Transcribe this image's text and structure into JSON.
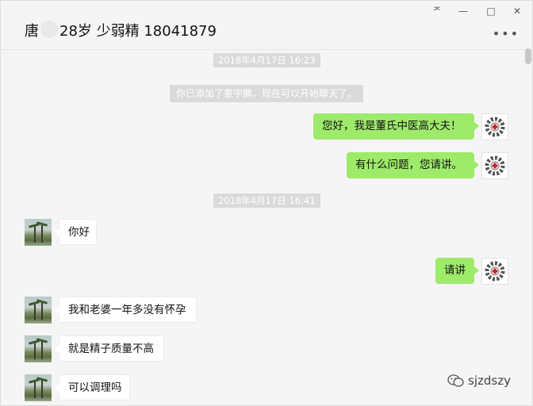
{
  "window": {
    "title_prefix": "唐",
    "title_suffix": "28岁 少弱精 18041879",
    "controls": [
      "ᅎ",
      "—",
      "□",
      "✕"
    ],
    "more_label": "•••"
  },
  "timestamps": [
    "2018年4月17日 16:23",
    "2018年4月17日 16:41"
  ],
  "system_message": "你已添加了董宇鹏，现在可以开始聊天了。",
  "messages": [
    {
      "side": "out",
      "text": "您好，我是董氏中医高大夫！"
    },
    {
      "side": "out",
      "text": "有什么问题，您请讲。"
    },
    {
      "side": "in",
      "text": "你好"
    },
    {
      "side": "out",
      "text": "请讲"
    },
    {
      "side": "in",
      "text": "我和老婆一年多没有怀孕"
    },
    {
      "side": "in",
      "text": "就是精子质量不高"
    },
    {
      "side": "in",
      "text": "可以调理吗"
    }
  ],
  "watermark": "sjzdszy",
  "colors": {
    "outgoing": "#9eea6a",
    "incoming": "#ffffff",
    "background": "#f5f5f5"
  }
}
